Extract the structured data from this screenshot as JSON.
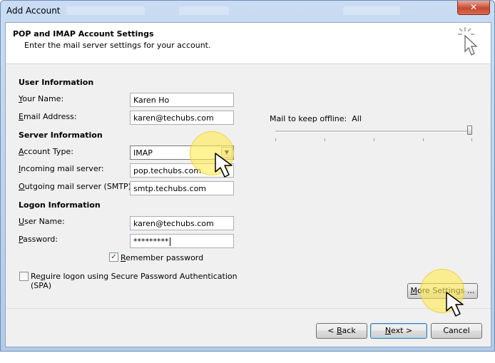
{
  "window": {
    "title": "Add Account",
    "close_label": "✕"
  },
  "header": {
    "title": "POP and IMAP Account Settings",
    "subtitle": "Enter the mail server settings for your account.",
    "icon": "cursor-sparkle-icon"
  },
  "user_info": {
    "heading": "User Information",
    "your_name_label": "Your Name:",
    "your_name_value": "Karen Ho",
    "email_label": "Email Address:",
    "email_value": "karen@techubs.com"
  },
  "server_info": {
    "heading": "Server Information",
    "account_type_label": "Account Type:",
    "account_type_value": "IMAP",
    "incoming_label": "Incoming mail server:",
    "incoming_value": "pop.techubs.com",
    "outgoing_label": "Outgoing mail server (SMTP):",
    "outgoing_value": "smtp.techubs.com"
  },
  "logon_info": {
    "heading": "Logon Information",
    "username_label": "User Name:",
    "username_value": "karen@techubs.com",
    "password_label": "Password:",
    "password_value": "*********",
    "remember_label": "Remember password",
    "remember_checked": true,
    "spa_label": "Require logon using Secure Password Authentication (SPA)",
    "spa_checked": false
  },
  "offline": {
    "label": "Mail to keep offline:",
    "value": "All",
    "slider_fraction": 1.0
  },
  "buttons": {
    "more_settings": "More Settings ...",
    "back": "< Back",
    "next": "Next >",
    "cancel": "Cancel"
  },
  "colors": {
    "highlight": "#ffeb50",
    "titlebar": "#c9dcf3",
    "close": "#c74a30"
  }
}
